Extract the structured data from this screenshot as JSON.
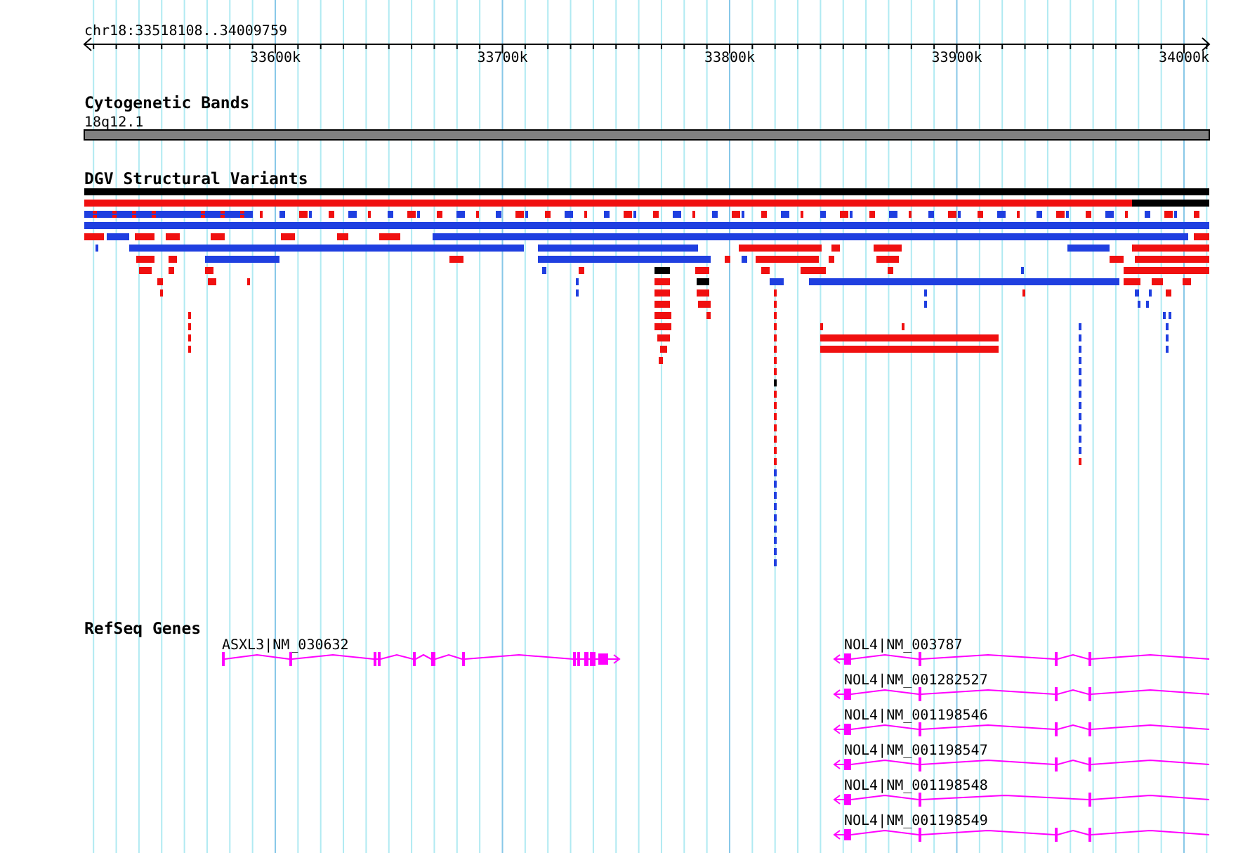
{
  "location": "chr18:33518108..34009759",
  "ruler": {
    "ticks": [
      "33600k",
      "33700k",
      "33800k",
      "33900k",
      "34000k"
    ]
  },
  "tracks": [
    {
      "kind": "bands",
      "title": "Cytogenetic Bands",
      "bands": [
        {
          "label": "18q12.1"
        }
      ]
    },
    {
      "kind": "variants",
      "title": "DGV Structural Variants"
    },
    {
      "kind": "genes",
      "title": "RefSeq Genes",
      "genes": [
        {
          "label": "ASXL3|NM_030632",
          "kind": "forward"
        },
        {
          "label": "NOL4|NM_003787",
          "kind": "reverse"
        },
        {
          "label": "NOL4|NM_001282527",
          "kind": "reverse"
        },
        {
          "label": "NOL4|NM_001198546",
          "kind": "reverse"
        },
        {
          "label": "NOL4|NM_001198547",
          "kind": "reverse"
        },
        {
          "label": "NOL4|NM_001198548",
          "kind": "reverse"
        },
        {
          "label": "NOL4|NM_001198549",
          "kind": "reverse"
        }
      ]
    }
  ]
}
